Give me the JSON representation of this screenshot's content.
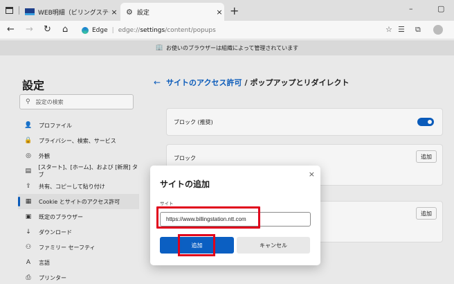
{
  "tabs": [
    {
      "title": "WEB明細（ビリングステーション）| ",
      "close": "×"
    },
    {
      "title": "設定",
      "close": "×"
    }
  ],
  "new_tab": "+",
  "window_controls": {
    "minimize": "–",
    "maximize": "▢"
  },
  "nav": {
    "back": "←",
    "forward": "→",
    "reload": "↻",
    "home": "⌂"
  },
  "address": {
    "site": "Edge",
    "separator": "|",
    "prefix": "edge://",
    "host": "settings",
    "path": "/content/popups"
  },
  "banner": {
    "text": "お使いのブラウザーは組織によって管理されています"
  },
  "settings": {
    "title": "設定",
    "search_placeholder": "設定の検索",
    "nav_items": [
      {
        "label": "プロファイル",
        "icon": "👤"
      },
      {
        "label": "プライバシー、検索、サービス",
        "icon": "🔒"
      },
      {
        "label": "外観",
        "icon": "◎"
      },
      {
        "label": "[スタート]、[ホーム]、および [新規] タブ",
        "icon": "▤"
      },
      {
        "label": "共有、コピーして貼り付け",
        "icon": "⇪"
      },
      {
        "label": "Cookie とサイトのアクセス許可",
        "icon": "▦"
      },
      {
        "label": "既定のブラウザー",
        "icon": "▣"
      },
      {
        "label": "ダウンロード",
        "icon": "↓"
      },
      {
        "label": "ファミリー セーフティ",
        "icon": "⚇"
      },
      {
        "label": "言語",
        "icon": "A"
      },
      {
        "label": "プリンター",
        "icon": "⎙"
      }
    ],
    "active_nav": "Cookie とサイトのアクセス許可",
    "breadcrumb": {
      "back": "←",
      "parent": "サイトのアクセス許可",
      "separator": "/",
      "current": "ポップアップとリダイレクト"
    },
    "block_recommended": {
      "label": "ブロック (推奨)",
      "enabled": true
    },
    "block_section": {
      "label": "ブロック",
      "add": "追加"
    },
    "allow_section": {
      "add": "追加"
    }
  },
  "dialog": {
    "title": "サイトの追加",
    "close": "×",
    "field_label": "サイト",
    "field_value": "https://www.billingstation.ntt.com",
    "add": "追加",
    "cancel": "キャンセル"
  },
  "colors": {
    "accent": "#0b5fc2",
    "highlight": "#e0001b"
  }
}
